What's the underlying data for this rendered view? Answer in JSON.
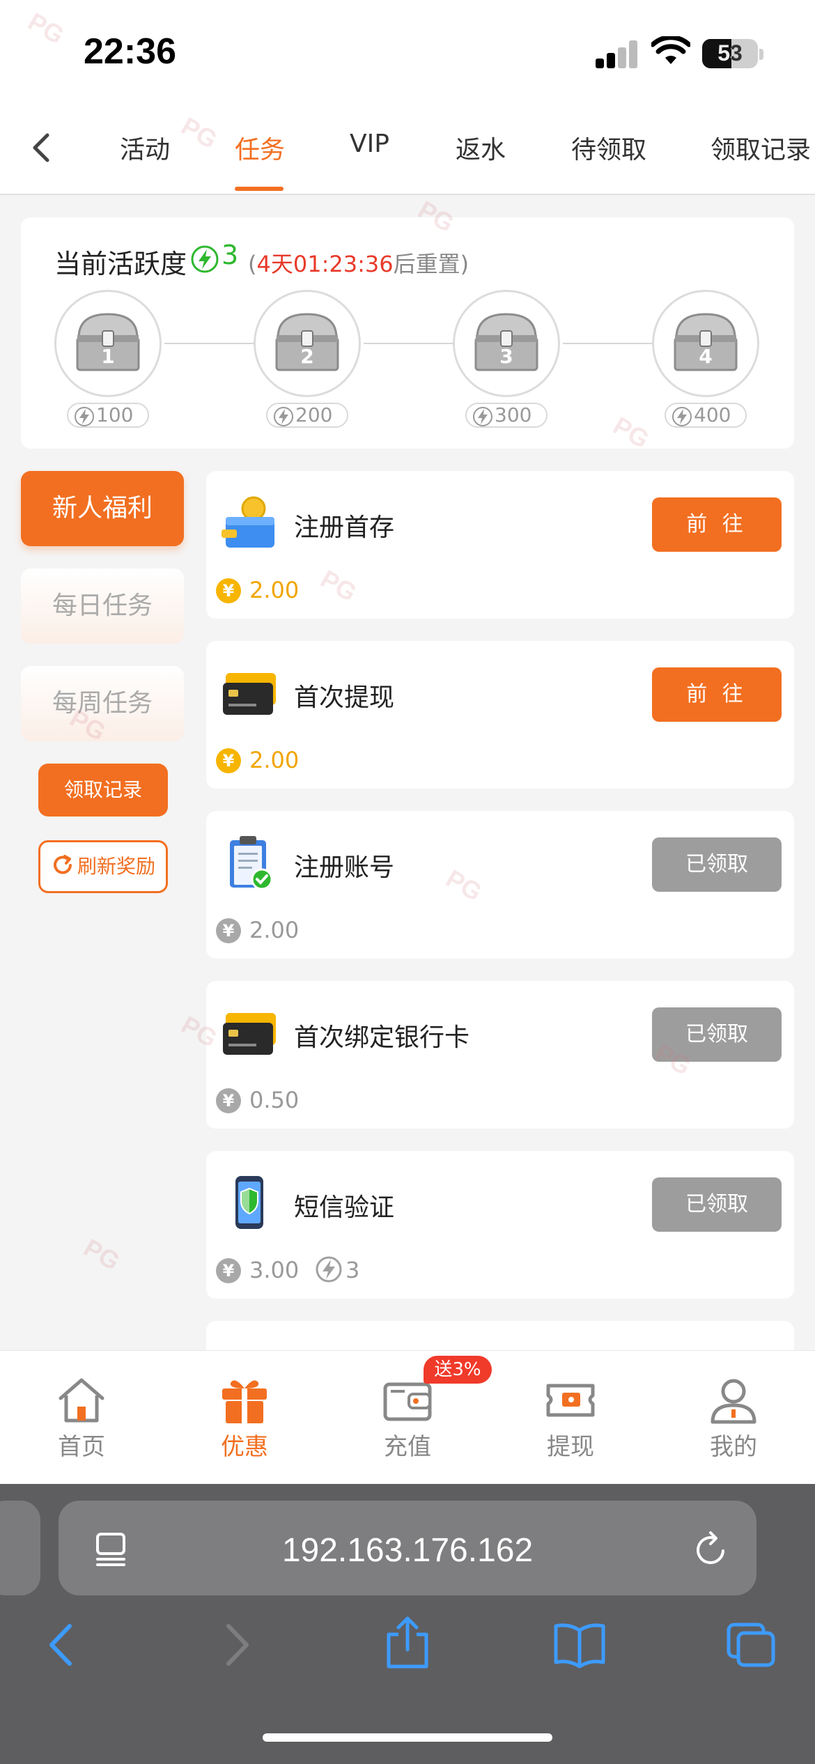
{
  "status": {
    "time": "22:36",
    "battery": "53"
  },
  "tabs": [
    {
      "label": "活动"
    },
    {
      "label": "任务",
      "active": true
    },
    {
      "label": "VIP"
    },
    {
      "label": "返水"
    },
    {
      "label": "待领取"
    },
    {
      "label": "领取记录"
    }
  ],
  "activity": {
    "title": "当前活跃度",
    "count": "3",
    "reset_open": "(",
    "reset_time": "4天01:23:36",
    "reset_suffix": "后重置)",
    "chests": [
      {
        "num": "1",
        "points": "100"
      },
      {
        "num": "2",
        "points": "200"
      },
      {
        "num": "3",
        "points": "300"
      },
      {
        "num": "4",
        "points": "400"
      }
    ]
  },
  "sidebar": {
    "items": [
      {
        "label": "新人福利",
        "active": true
      },
      {
        "label": "每日任务"
      },
      {
        "label": "每周任务"
      }
    ],
    "records_button": "领取记录",
    "refresh_button": "刷新奖励"
  },
  "tasks": [
    {
      "name": "注册首存",
      "reward": "2.00",
      "button": "前 往",
      "state": "go",
      "icon": "wallet-coin-icon"
    },
    {
      "name": "首次提现",
      "reward": "2.00",
      "button": "前 往",
      "state": "go",
      "icon": "bank-card-icon"
    },
    {
      "name": "注册账号",
      "reward": "2.00",
      "button": "已领取",
      "state": "done",
      "icon": "clipboard-check-icon"
    },
    {
      "name": "首次绑定银行卡",
      "reward": "0.50",
      "button": "已领取",
      "state": "done",
      "icon": "bank-card-icon"
    },
    {
      "name": "短信验证",
      "reward": "3.00",
      "extra": "3",
      "button": "已领取",
      "state": "done",
      "icon": "phone-shield-icon"
    }
  ],
  "currency_symbol": "¥",
  "bottom_nav": [
    {
      "label": "首页",
      "icon": "home-icon"
    },
    {
      "label": "优惠",
      "icon": "gift-icon",
      "active": true
    },
    {
      "label": "充值",
      "icon": "wallet-icon",
      "badge": "送3%"
    },
    {
      "label": "提现",
      "icon": "ticket-icon"
    },
    {
      "label": "我的",
      "icon": "user-icon"
    }
  ],
  "browser": {
    "url": "192.163.176.162"
  },
  "colors": {
    "accent": "#f26f21",
    "done": "#9d9d9d",
    "reward_gold": "#f0a500",
    "bolt_green": "#2eb82e"
  },
  "watermark": "PG"
}
